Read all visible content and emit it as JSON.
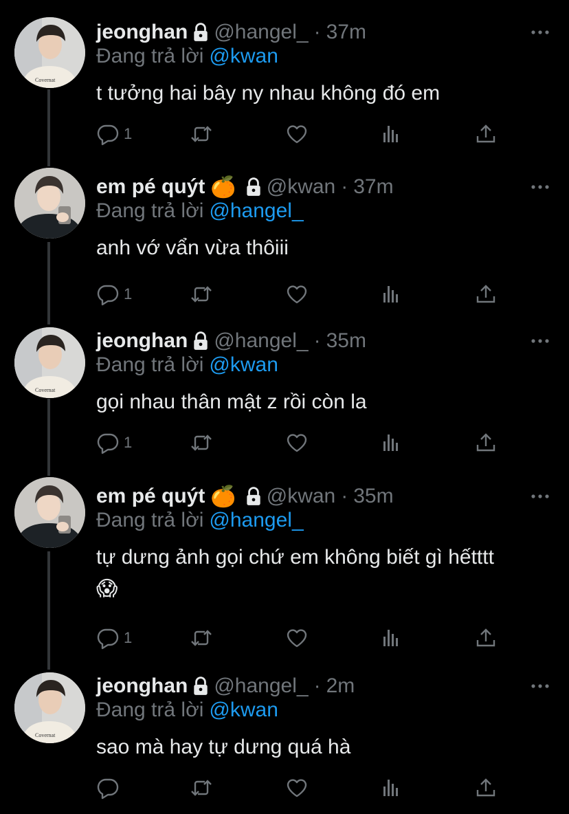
{
  "tweets": [
    {
      "name": "jeonghan",
      "name_emoji": "",
      "handle": "@hangel_",
      "time": "37m",
      "reply_prefix": "Đang trả lời",
      "reply_to": "@kwan",
      "text": "t tưởng hai bây ny nhau không đó em",
      "reply_count": "1",
      "avatar": "jeonghan-avatar",
      "locked": true
    },
    {
      "name": "em pé quýt",
      "name_emoji": "🍊",
      "handle": "@kwan",
      "time": "37m",
      "reply_prefix": "Đang trả lời",
      "reply_to": "@hangel_",
      "text": "anh vớ vẩn vừa thôiii",
      "reply_count": "1",
      "avatar": "kwan-avatar",
      "locked": true
    },
    {
      "name": "jeonghan",
      "name_emoji": "",
      "handle": "@hangel_",
      "time": "35m",
      "reply_prefix": "Đang trả lời",
      "reply_to": "@kwan",
      "text": "gọi nhau thân mật z rồi còn la",
      "reply_count": "1",
      "avatar": "jeonghan-avatar",
      "locked": true
    },
    {
      "name": "em pé quýt",
      "name_emoji": "🍊",
      "handle": "@kwan",
      "time": "35m",
      "reply_prefix": "Đang trả lời",
      "reply_to": "@hangel_",
      "text": "tự dưng ảnh gọi chứ em không biết gì hếtttt",
      "text_emoji": "😱",
      "reply_count": "1",
      "avatar": "kwan-avatar",
      "locked": true
    },
    {
      "name": "jeonghan",
      "name_emoji": "",
      "handle": "@hangel_",
      "time": "2m",
      "reply_prefix": "Đang trả lời",
      "reply_to": "@kwan",
      "text": "sao mà hay tự dưng quá hà",
      "reply_count": "",
      "avatar": "jeonghan-avatar",
      "locked": true
    }
  ],
  "colors": {
    "background": "#000000",
    "text": "#e7e9ea",
    "muted": "#71767b",
    "accent": "#1d9bf0",
    "thread_line": "#333639"
  },
  "icons": [
    "lock-icon",
    "more-icon",
    "reply-icon",
    "retweet-icon",
    "like-icon",
    "views-icon",
    "share-icon"
  ]
}
